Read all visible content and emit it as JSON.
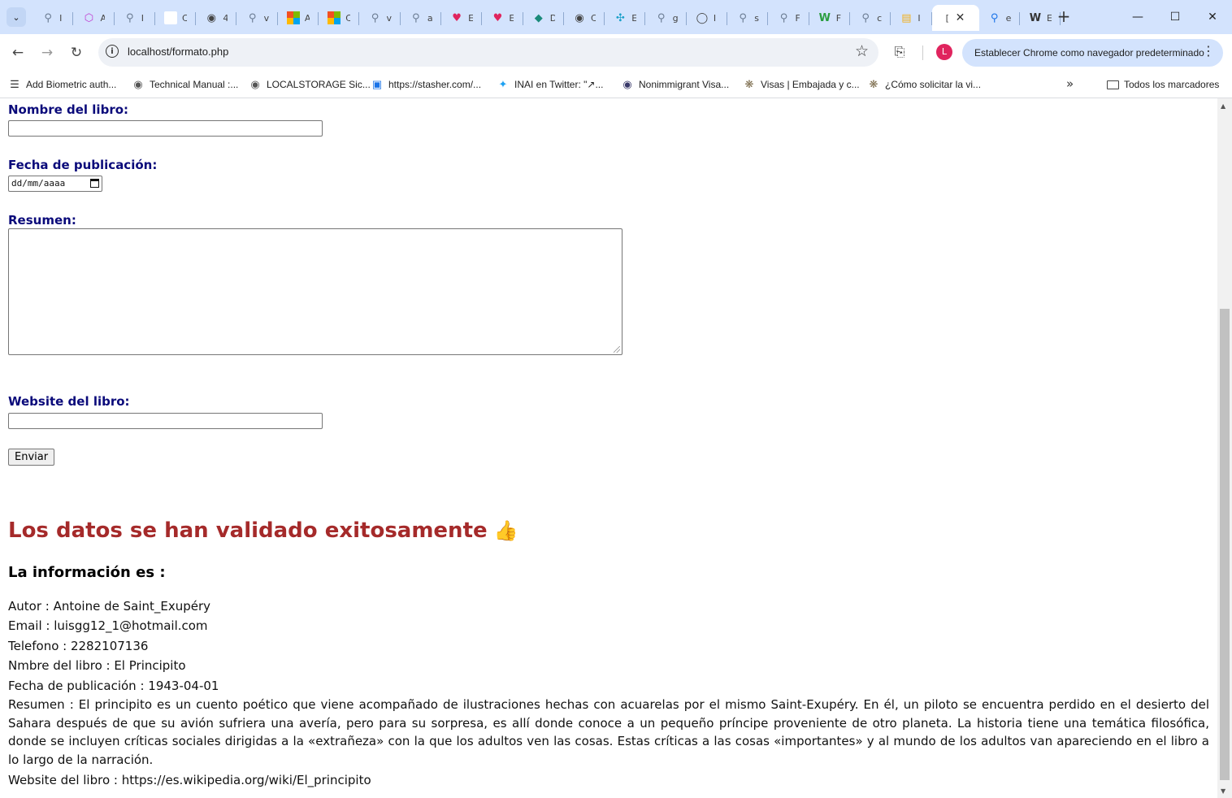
{
  "browser": {
    "tabs": [
      {
        "char": "I",
        "icon": "search-icon",
        "color": "#6b7c93"
      },
      {
        "char": "A",
        "icon": "cube-icon",
        "color": "#c03ad0"
      },
      {
        "char": "I",
        "icon": "search-icon",
        "color": "#6b7c93"
      },
      {
        "char": "C",
        "icon": "blank-page-icon",
        "color": "#ffffff"
      },
      {
        "char": "4",
        "icon": "globe-icon",
        "color": "#444444"
      },
      {
        "char": "v",
        "icon": "search-icon",
        "color": "#6b7c93"
      },
      {
        "char": "A",
        "icon": "microsoft-icon",
        "color": "#f25022"
      },
      {
        "char": "C",
        "icon": "microsoft-icon",
        "color": "#f25022"
      },
      {
        "char": "v",
        "icon": "search-icon",
        "color": "#6b7c93"
      },
      {
        "char": "a",
        "icon": "search-icon",
        "color": "#6b7c93"
      },
      {
        "char": "E",
        "icon": "heart-icon",
        "color": "#e0245e"
      },
      {
        "char": "E",
        "icon": "heart-icon",
        "color": "#e0245e"
      },
      {
        "char": "D",
        "icon": "diamond-icon",
        "color": "#1a8a7a"
      },
      {
        "char": "C",
        "icon": "globe-icon",
        "color": "#444444"
      },
      {
        "char": "E",
        "icon": "crosshair-icon",
        "color": "#1aa0c9"
      },
      {
        "char": "g",
        "icon": "search-icon",
        "color": "#6b7c93"
      },
      {
        "char": "I",
        "icon": "github-icon",
        "color": "#444444"
      },
      {
        "char": "s",
        "icon": "search-icon",
        "color": "#6b7c93"
      },
      {
        "char": "F",
        "icon": "search-icon",
        "color": "#6b7c93"
      },
      {
        "char": "F",
        "icon": "w-logo-icon",
        "color": "#2a9d3f"
      },
      {
        "char": "c",
        "icon": "search-icon",
        "color": "#6b7c93"
      },
      {
        "char": "I",
        "icon": "doc-icon",
        "color": "#f2b01e"
      }
    ],
    "active_tab": {
      "char": "[",
      "close": "✕"
    },
    "extra_tabs": [
      {
        "char": "e",
        "icon": "search-icon",
        "color": "#1a73e8"
      },
      {
        "char": "E",
        "icon": "wikipedia-icon",
        "color": "#333333"
      }
    ],
    "url": "localhost/formato.php",
    "default_browser_label": "Establecer Chrome como navegador predeterminado",
    "profile_initial": "L",
    "bookmarks": [
      {
        "label": "Add Biometric auth...",
        "icon": "ladder-icon",
        "color": "#333333"
      },
      {
        "label": "Technical Manual :...",
        "icon": "globe-icon",
        "color": "#555555"
      },
      {
        "label": "LOCALSTORAGE Sic...",
        "icon": "globe-icon",
        "color": "#555555"
      },
      {
        "label": "https://stasher.com/...",
        "icon": "box-icon",
        "color": "#1a73e8"
      },
      {
        "label": "INAI en Twitter: \"↗...",
        "icon": "twitter-icon",
        "color": "#1da1f2"
      },
      {
        "label": "Nonimmigrant Visa...",
        "icon": "seal-icon",
        "color": "#3a3a6a"
      },
      {
        "label": "Visas | Embajada y c...",
        "icon": "eagle-icon",
        "color": "#7a6a4a"
      },
      {
        "label": "¿Cómo solicitar la vi...",
        "icon": "eagle-icon",
        "color": "#7a6a4a"
      }
    ],
    "all_bookmarks_label": "Todos los marcadores"
  },
  "form": {
    "book_name_label": "Nombre del libro:",
    "pub_date_label": "Fecha de publicación:",
    "pub_date_placeholder": "dd/mm/aaaa",
    "summary_label": "Resumen:",
    "website_label": "Website del libro:",
    "submit_label": "Enviar"
  },
  "result": {
    "success_message": "Los datos se han validado exitosamente",
    "info_heading": "La información es :",
    "author": "Autor : Antoine de Saint_Exupéry",
    "email": "Email : luisgg12_1@hotmail.com",
    "phone": "Telefono : 2282107136",
    "book_name": "Nmbre del libro : El Principito",
    "pub_date": "Fecha de publicación : 1943-04-01",
    "summary": "Resumen : El principito es un cuento poético que viene acompañado de ilustraciones hechas con acuarelas por el mismo Saint-Exupéry. En él, un piloto se encuentra perdido en el desierto del Sahara después de que su avión sufriera una avería, pero para su sorpresa, es allí donde conoce a un pequeño príncipe proveniente de otro planeta. La historia tiene una temática filosófica, donde se incluyen críticas sociales dirigidas a la «extrañeza» con la que los adultos ven las cosas. Estas críticas a las cosas «importantes» y al mundo de los adultos van apareciendo en el libro a lo largo de la narración.",
    "website": "Website del libro : https://es.wikipedia.org/wiki/El_principito"
  }
}
